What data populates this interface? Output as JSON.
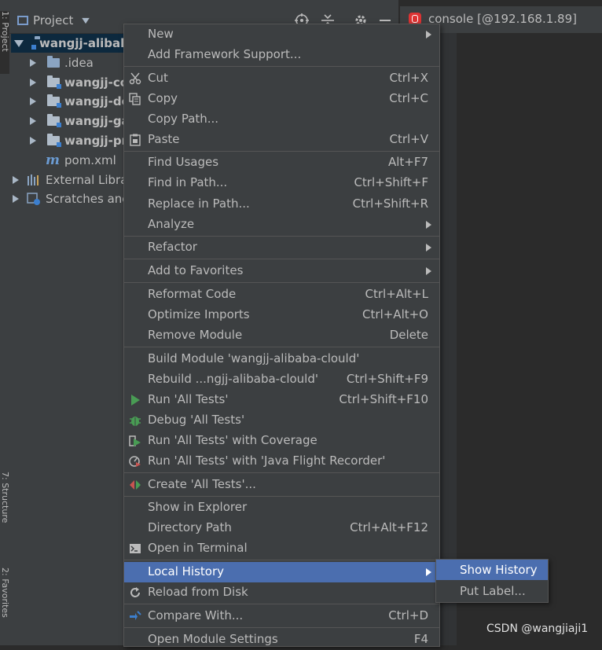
{
  "left_strip": {
    "project_tab": "1: Project",
    "structure_tab": "7: Structure",
    "favorites_tab": "2: Favorites"
  },
  "project_panel": {
    "title": "Project",
    "tree": [
      {
        "label": "wangjj-alibaba",
        "bold": true,
        "expanded": true
      },
      {
        "label": ".idea",
        "bold": false
      },
      {
        "label": "wangjj-cor",
        "bold": true
      },
      {
        "label": "wangjj-dea",
        "bold": true
      },
      {
        "label": "wangjj-gat",
        "bold": true
      },
      {
        "label": "wangjj-pro",
        "bold": true
      },
      {
        "label": "pom.xml",
        "bold": false,
        "icon_text": "m"
      },
      {
        "label": "External Librar",
        "bold": false
      },
      {
        "label": "Scratches and",
        "bold": false
      }
    ]
  },
  "editor": {
    "tab_label": "console [@192.168.1.89]"
  },
  "context_menu": {
    "items": [
      {
        "label": "New",
        "shortcut": "",
        "submenu": true
      },
      {
        "label": "Add Framework Support...",
        "shortcut": ""
      },
      {
        "label": "Cut",
        "shortcut": "Ctrl+X",
        "icon": "scissors-icon"
      },
      {
        "label": "Copy",
        "shortcut": "Ctrl+C",
        "icon": "copy-icon"
      },
      {
        "label": "Copy Path...",
        "shortcut": ""
      },
      {
        "label": "Paste",
        "shortcut": "Ctrl+V",
        "icon": "clipboard-icon"
      },
      {
        "label": "Find Usages",
        "shortcut": "Alt+F7"
      },
      {
        "label": "Find in Path...",
        "shortcut": "Ctrl+Shift+F"
      },
      {
        "label": "Replace in Path...",
        "shortcut": "Ctrl+Shift+R"
      },
      {
        "label": "Analyze",
        "shortcut": "",
        "submenu": true
      },
      {
        "label": "Refactor",
        "shortcut": "",
        "submenu": true
      },
      {
        "label": "Add to Favorites",
        "shortcut": "",
        "submenu": true
      },
      {
        "label": "Reformat Code",
        "shortcut": "Ctrl+Alt+L"
      },
      {
        "label": "Optimize Imports",
        "shortcut": "Ctrl+Alt+O"
      },
      {
        "label": "Remove Module",
        "shortcut": "Delete"
      },
      {
        "label": "Build Module 'wangjj-alibaba-clould'",
        "shortcut": ""
      },
      {
        "label": "Rebuild ...ngjj-alibaba-clould'",
        "shortcut": "Ctrl+Shift+F9"
      },
      {
        "label": "Run 'All Tests'",
        "shortcut": "Ctrl+Shift+F10",
        "icon": "run-icon"
      },
      {
        "label": "Debug 'All Tests'",
        "shortcut": "",
        "icon": "debug-icon"
      },
      {
        "label": "Run 'All Tests' with Coverage",
        "shortcut": "",
        "icon": "coverage-icon"
      },
      {
        "label": "Run 'All Tests' with 'Java Flight Recorder'",
        "shortcut": "",
        "icon": "profiler-icon"
      },
      {
        "label": "Create 'All Tests'...",
        "shortcut": "",
        "icon": "create-test-icon"
      },
      {
        "label": "Show in Explorer",
        "shortcut": ""
      },
      {
        "label": "Directory Path",
        "shortcut": "Ctrl+Alt+F12"
      },
      {
        "label": "Open in Terminal",
        "shortcut": "",
        "icon": "terminal-icon"
      },
      {
        "label": "Local History",
        "shortcut": "",
        "submenu": true,
        "selected": true
      },
      {
        "label": "Reload from Disk",
        "shortcut": "",
        "icon": "reload-icon"
      },
      {
        "label": "Compare With...",
        "shortcut": "Ctrl+D",
        "icon": "compare-icon"
      },
      {
        "label": "Open Module Settings",
        "shortcut": "F4"
      }
    ]
  },
  "submenu": {
    "items": [
      {
        "label": "Show History",
        "selected": true
      },
      {
        "label": "Put Label..."
      }
    ]
  },
  "watermark": "CSDN @wangjiaji1",
  "colors": {
    "selection": "#4b6eaf",
    "panel": "#3c3f41",
    "editor": "#2b2b2b",
    "tree_selection": "#0d293e"
  }
}
